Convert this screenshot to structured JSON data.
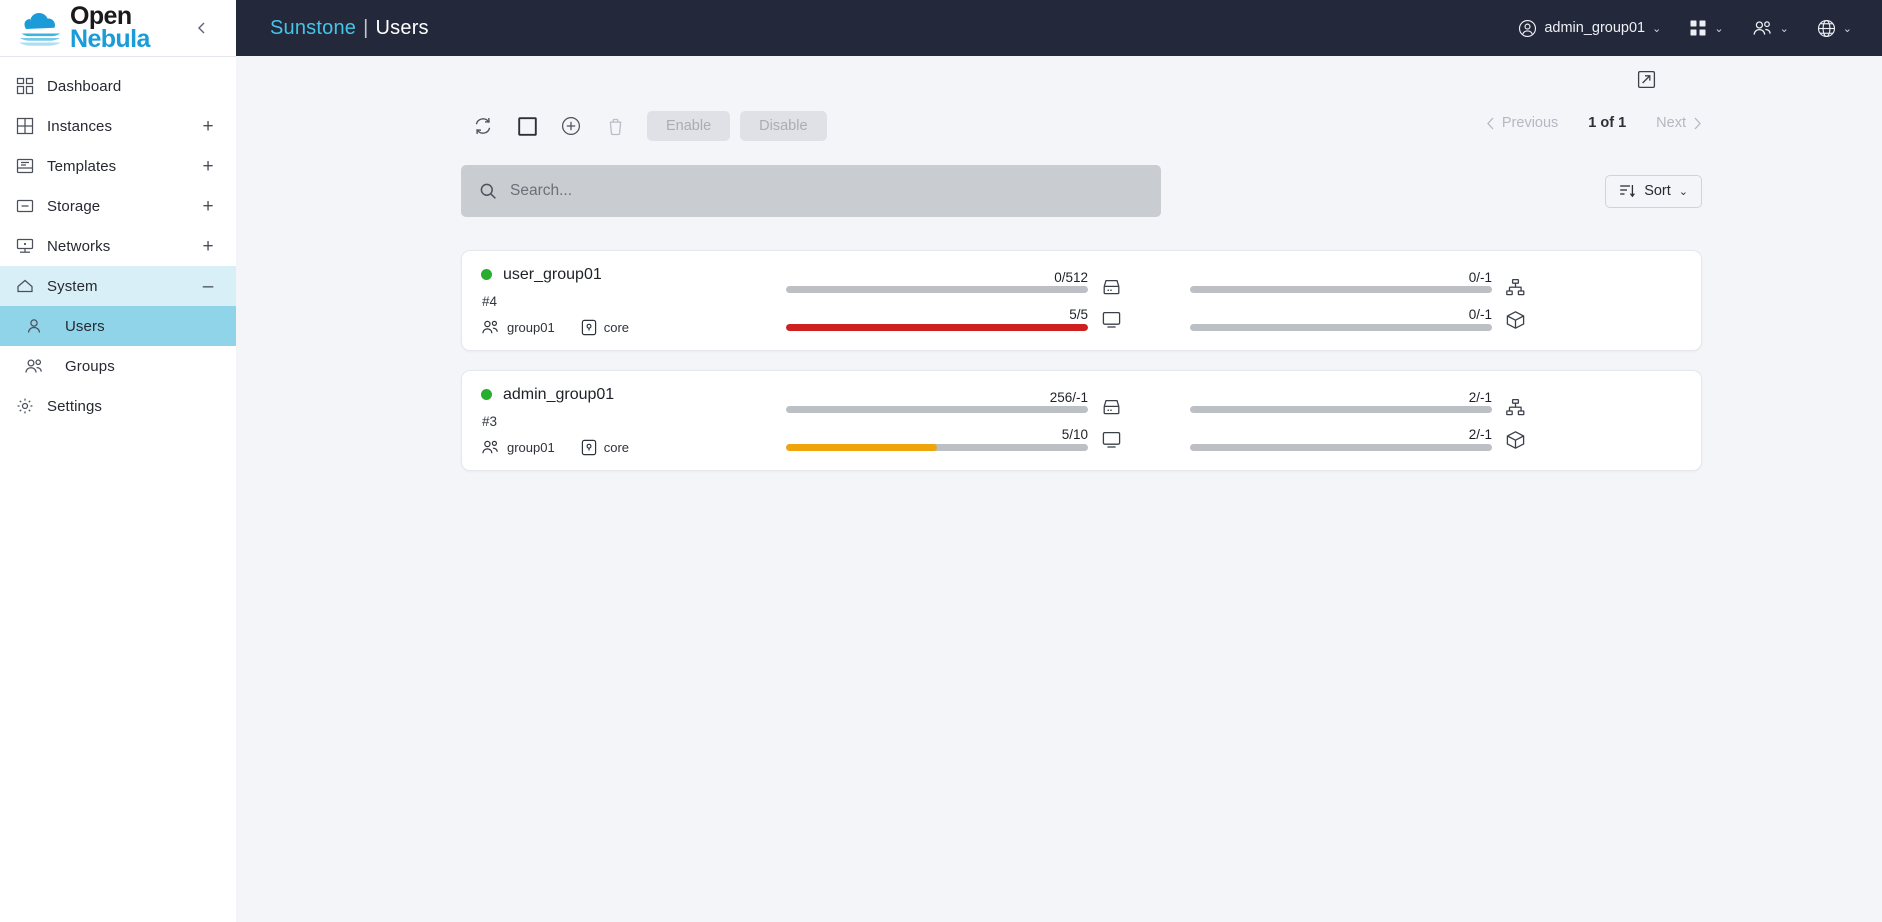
{
  "sidebar": {
    "logo": {
      "line1": "Open",
      "line2": "Nebula",
      "collapse_icon": "chevron-left-icon"
    },
    "items": [
      {
        "label": "Dashboard",
        "icon": "dashboard-icon",
        "expand": "",
        "state": "normal"
      },
      {
        "label": "Instances",
        "icon": "grid-icon",
        "expand": "+",
        "state": "normal"
      },
      {
        "label": "Templates",
        "icon": "template-icon",
        "expand": "+",
        "state": "normal"
      },
      {
        "label": "Storage",
        "icon": "storage-icon",
        "expand": "+",
        "state": "normal"
      },
      {
        "label": "Networks",
        "icon": "network-icon",
        "expand": "+",
        "state": "normal"
      },
      {
        "label": "System",
        "icon": "home-icon",
        "expand": "–",
        "state": "expanded"
      }
    ],
    "subitems": [
      {
        "label": "Users",
        "icon": "user-icon",
        "selected": true
      },
      {
        "label": "Groups",
        "icon": "users-icon",
        "selected": false
      }
    ],
    "settings": {
      "label": "Settings",
      "icon": "gear-icon"
    }
  },
  "topbar": {
    "app_name": "Sunstone",
    "separator": "|",
    "page_name": "Users",
    "user": {
      "label": "admin_group01",
      "icon": "user-circle-icon",
      "caret": "⌄"
    },
    "zone_menu": {
      "icon": "apps-grid-icon",
      "caret": "⌄"
    },
    "group_menu": {
      "icon": "users-icon",
      "caret": "⌄"
    },
    "language_menu": {
      "icon": "globe-icon",
      "caret": "⌄"
    }
  },
  "toolbar": {
    "expand_view_icon": "expand-view-icon",
    "refresh_icon": "refresh-icon",
    "select_all_icon": "select-all-icon",
    "add_icon": "add-circle-icon",
    "delete_icon": "trash-icon",
    "enable_label": "Enable",
    "disable_label": "Disable"
  },
  "pagination": {
    "previous_label": "Previous",
    "page_label": "1 of 1",
    "next_label": "Next"
  },
  "search": {
    "placeholder": "Search...",
    "value": "",
    "icon": "search-icon"
  },
  "sort": {
    "label": "Sort",
    "icon": "sort-icon",
    "caret": "⌄"
  },
  "colors": {
    "accent": "#46c4e8",
    "topbar_bg": "#23283a",
    "selected_nav": "#90d4ea",
    "expanded_nav": "#d9eff8",
    "status_ok": "#27ae2f",
    "bar_track": "#bcbfc4",
    "bar_critical": "#cf2020",
    "bar_warning": "#f0a40c"
  },
  "users": [
    {
      "name": "user_group01",
      "status": "on",
      "id": "#4",
      "group": "group01",
      "auth_driver": "core",
      "group_icon": "users-icon",
      "auth_icon": "lock-icon",
      "quotas": [
        {
          "icon": "datastore-icon",
          "label": "0/512",
          "percent": 0,
          "color": "none"
        },
        {
          "icon": "vm-icon",
          "label": "5/5",
          "percent": 100,
          "color": "#cf2020"
        },
        {
          "icon": "network-quota-icon",
          "label": "0/-1",
          "percent": 0,
          "color": "none"
        },
        {
          "icon": "image-quota-icon",
          "label": "0/-1",
          "percent": 0,
          "color": "none"
        }
      ]
    },
    {
      "name": "admin_group01",
      "status": "on",
      "id": "#3",
      "group": "group01",
      "auth_driver": "core",
      "group_icon": "users-icon",
      "auth_icon": "lock-icon",
      "quotas": [
        {
          "icon": "datastore-icon",
          "label": "256/-1",
          "percent": 0,
          "color": "none"
        },
        {
          "icon": "vm-icon",
          "label": "5/10",
          "percent": 50,
          "color": "#f0a40c"
        },
        {
          "icon": "network-quota-icon",
          "label": "2/-1",
          "percent": 0,
          "color": "none"
        },
        {
          "icon": "image-quota-icon",
          "label": "2/-1",
          "percent": 0,
          "color": "none"
        }
      ]
    }
  ]
}
